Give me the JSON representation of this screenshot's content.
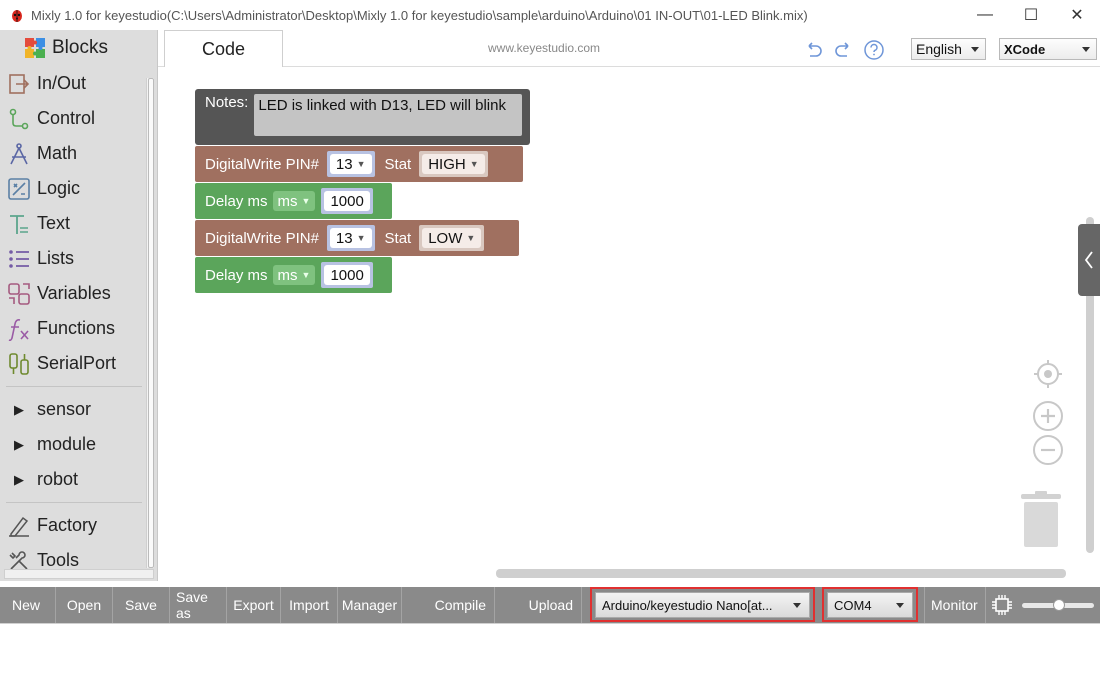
{
  "window": {
    "title": "Mixly 1.0 for keyestudio(C:\\Users\\Administrator\\Desktop\\Mixly 1.0 for keyestudio\\sample\\arduino\\Arduino\\01 IN-OUT\\01-LED Blink.mix)",
    "minimize": "—",
    "maximize": "☐",
    "close": "✕"
  },
  "sidebar": {
    "header": "Blocks",
    "categories": [
      {
        "label": "In/Out",
        "icon": "in-out-icon"
      },
      {
        "label": "Control",
        "icon": "control-icon"
      },
      {
        "label": "Math",
        "icon": "math-icon"
      },
      {
        "label": "Logic",
        "icon": "logic-icon"
      },
      {
        "label": "Text",
        "icon": "text-icon"
      },
      {
        "label": "Lists",
        "icon": "lists-icon"
      },
      {
        "label": "Variables",
        "icon": "variables-icon"
      },
      {
        "label": "Functions",
        "icon": "functions-icon"
      },
      {
        "label": "SerialPort",
        "icon": "serial-port-icon"
      }
    ],
    "groups": [
      "sensor",
      "module",
      "robot"
    ],
    "extras": [
      {
        "label": "Factory",
        "icon": "factory-icon"
      },
      {
        "label": "Tools",
        "icon": "tools-icon"
      }
    ]
  },
  "topbar": {
    "code_tab": "Code",
    "site": "www.keyestudio.com",
    "language": "English",
    "code_style": "XCode"
  },
  "blocks": {
    "notes_label": "Notes:",
    "notes_text": "LED is linked with D13, LED will blink",
    "dw_label": "DigitalWrite PIN#",
    "stat_label": "Stat",
    "delay_label": "Delay ms",
    "unit": "ms",
    "pin": "13",
    "stat_high": "HIGH",
    "stat_low": "LOW",
    "delay_value": "1000"
  },
  "toolbar": {
    "new": "New",
    "open": "Open",
    "save": "Save",
    "save_as": "Save as",
    "export": "Export",
    "import": "Import",
    "manager": "Manager",
    "compile": "Compile",
    "upload": "Upload",
    "board": "Arduino/keyestudio Nano[at...",
    "port": "COM4",
    "monitor": "Monitor"
  },
  "colors": {
    "digitalwrite_block": "#a07060",
    "delay_block": "#5ba55b",
    "notes_block": "#555555",
    "highlight_frame": "#e03030"
  }
}
